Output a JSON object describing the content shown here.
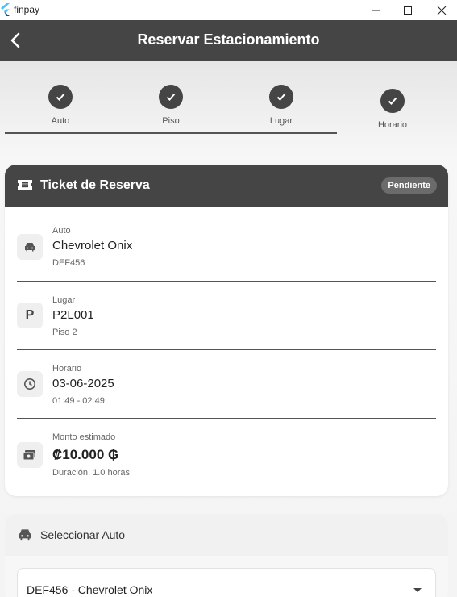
{
  "window": {
    "title": "finpay"
  },
  "appbar": {
    "title": "Reservar Estacionamiento"
  },
  "stepper": {
    "steps": [
      {
        "label": "Auto"
      },
      {
        "label": "Piso"
      },
      {
        "label": "Lugar"
      },
      {
        "label": "Horario"
      }
    ]
  },
  "ticket": {
    "title": "Ticket de Reserva",
    "status": "Pendiente",
    "auto": {
      "label": "Auto",
      "value": "Chevrolet Onix",
      "sub": "DEF456"
    },
    "lugar": {
      "label": "Lugar",
      "value": "P2L001",
      "sub": "Piso 2",
      "icon_letter": "P"
    },
    "horario": {
      "label": "Horario",
      "value": "03-06-2025",
      "sub": "01:49 - 02:49"
    },
    "monto": {
      "label": "Monto estimado",
      "value": "₡10.000 ₲",
      "sub": "Duración: 1.0 horas"
    }
  },
  "select_auto": {
    "title": "Seleccionar Auto",
    "selected": "DEF456 - Chevrolet Onix"
  },
  "colors": {
    "primary": "#454545",
    "background": "#f4f4f4"
  }
}
